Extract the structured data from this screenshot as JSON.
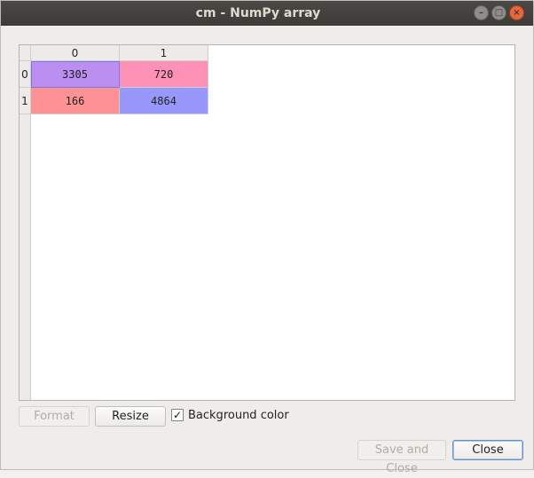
{
  "window": {
    "title": "cm - NumPy array",
    "buttons": {
      "minimize": "–",
      "maximize": "□",
      "close": "×"
    }
  },
  "table": {
    "column_headers": [
      "0",
      "1"
    ],
    "row_headers": [
      "0",
      "1"
    ],
    "rows": [
      [
        {
          "value": "3305",
          "color": "#bb8ff2"
        },
        {
          "value": "720",
          "color": "#fd90b5"
        }
      ],
      [
        {
          "value": "166",
          "color": "#fe9194"
        },
        {
          "value": "4864",
          "color": "#9898fc"
        }
      ]
    ]
  },
  "controls": {
    "format_label": "Format",
    "resize_label": "Resize",
    "background_color_label": "Background color",
    "background_color_checked": "✓",
    "save_and_close_label": "Save and Close",
    "close_label": "Close"
  }
}
